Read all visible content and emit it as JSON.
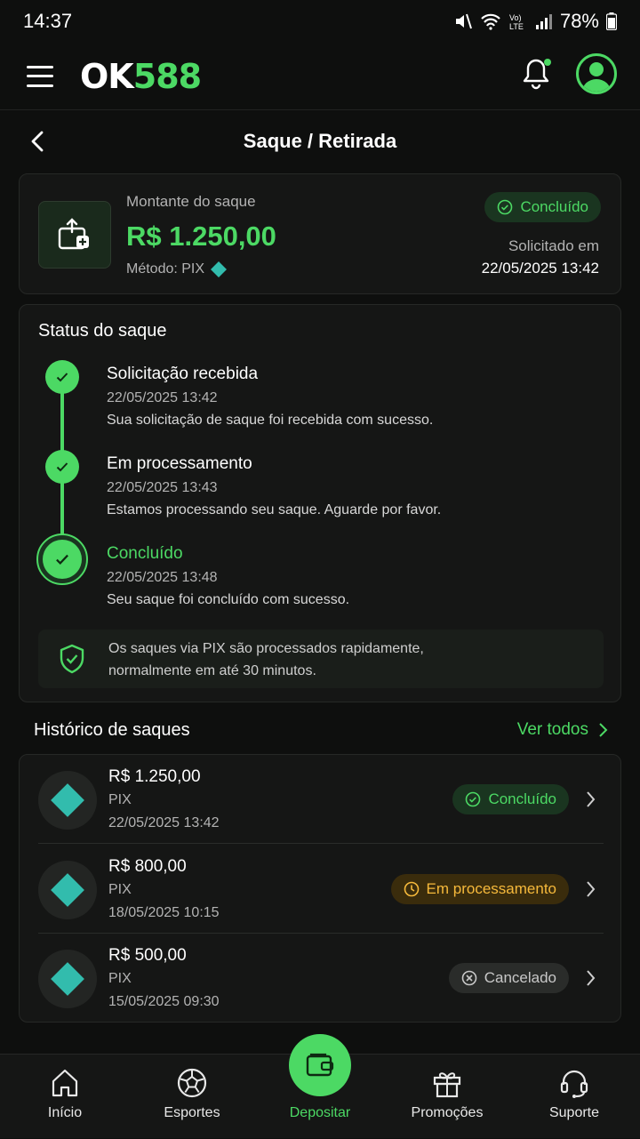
{
  "status_bar": {
    "time": "14:37",
    "battery": "78%"
  },
  "header": {
    "logo_ok": "OK",
    "logo_num": "588"
  },
  "page": {
    "title": "Saque / Retirada"
  },
  "withdrawal": {
    "amount_label": "Montante do saque",
    "amount": "R$ 1.250,00",
    "method": "Método: PIX",
    "status": "Concluído",
    "requested_label": "Solicitado em",
    "requested_at": "22/05/2025 13:42"
  },
  "status_section": {
    "title": "Status do saque",
    "steps": [
      {
        "title": "Solicitação recebida",
        "date": "22/05/2025 13:42",
        "desc": "Sua solicitação de saque foi recebida com sucesso."
      },
      {
        "title": "Em processamento",
        "date": "22/05/2025 13:43",
        "desc": "Estamos processando seu saque. Aguarde por favor."
      },
      {
        "title": "Concluído",
        "date": "22/05/2025 13:48",
        "desc": "Seu saque foi concluído com sucesso."
      }
    ],
    "info_line1": "Os saques via PIX são processados rapidamente,",
    "info_line2": "normalmente em até 30 minutos."
  },
  "history": {
    "title": "Histórico de saques",
    "see_all": "Ver todos",
    "items": [
      {
        "amount": "R$ 1.250,00",
        "method": "PIX",
        "date": "22/05/2025 13:42",
        "status": "Concluído"
      },
      {
        "amount": "R$ 800,00",
        "method": "PIX",
        "date": "18/05/2025 10:15",
        "status": "Em processamento"
      },
      {
        "amount": "R$ 500,00",
        "method": "PIX",
        "date": "15/05/2025 09:30",
        "status": "Cancelado"
      }
    ]
  },
  "nav": {
    "home": "Início",
    "sports": "Esportes",
    "deposit": "Depositar",
    "promos": "Promoções",
    "support": "Suporte"
  },
  "colors": {
    "accent": "#4cd964",
    "pending": "#f6b93b",
    "pix": "#32bcad",
    "background": "#0e0f0e"
  }
}
